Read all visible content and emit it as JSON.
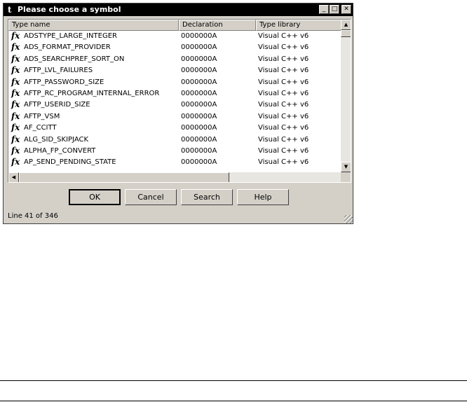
{
  "window": {
    "title": "Please choose a symbol",
    "app_icon": "t"
  },
  "titlebar_buttons": {
    "minimize": "_",
    "maximize": "□",
    "close": "✕"
  },
  "columns": [
    "Type name",
    "Declaration",
    "Type library"
  ],
  "rows": [
    {
      "icon": "fx",
      "name": "ADSTYPE_LARGE_INTEGER",
      "decl": "0000000A",
      "lib": "Visual C++ v6"
    },
    {
      "icon": "fx",
      "name": "ADS_FORMAT_PROVIDER",
      "decl": "0000000A",
      "lib": "Visual C++ v6"
    },
    {
      "icon": "fx",
      "name": "ADS_SEARCHPREF_SORT_ON",
      "decl": "0000000A",
      "lib": "Visual C++ v6"
    },
    {
      "icon": "fx",
      "name": "AFTP_LVL_FAILURES",
      "decl": "0000000A",
      "lib": "Visual C++ v6"
    },
    {
      "icon": "fx",
      "name": "AFTP_PASSWORD_SIZE",
      "decl": "0000000A",
      "lib": "Visual C++ v6"
    },
    {
      "icon": "fx",
      "name": "AFTP_RC_PROGRAM_INTERNAL_ERROR",
      "decl": "0000000A",
      "lib": "Visual C++ v6"
    },
    {
      "icon": "fx",
      "name": "AFTP_USERID_SIZE",
      "decl": "0000000A",
      "lib": "Visual C++ v6"
    },
    {
      "icon": "fx",
      "name": "AFTP_VSM",
      "decl": "0000000A",
      "lib": "Visual C++ v6"
    },
    {
      "icon": "fx",
      "name": "AF_CCITT",
      "decl": "0000000A",
      "lib": "Visual C++ v6"
    },
    {
      "icon": "fx",
      "name": "ALG_SID_SKIPJACK",
      "decl": "0000000A",
      "lib": "Visual C++ v6"
    },
    {
      "icon": "fx",
      "name": "ALPHA_FP_CONVERT",
      "decl": "0000000A",
      "lib": "Visual C++ v6"
    },
    {
      "icon": "fx",
      "name": "AP_SEND_PENDING_STATE",
      "decl": "0000000A",
      "lib": "Visual C++ v6"
    }
  ],
  "buttons": {
    "ok": "OK",
    "cancel": "Cancel",
    "search": "Search",
    "help": "Help"
  },
  "status": "Line 41 of 346",
  "scroll": {
    "up": "▲",
    "down": "▼",
    "left": "◀"
  }
}
